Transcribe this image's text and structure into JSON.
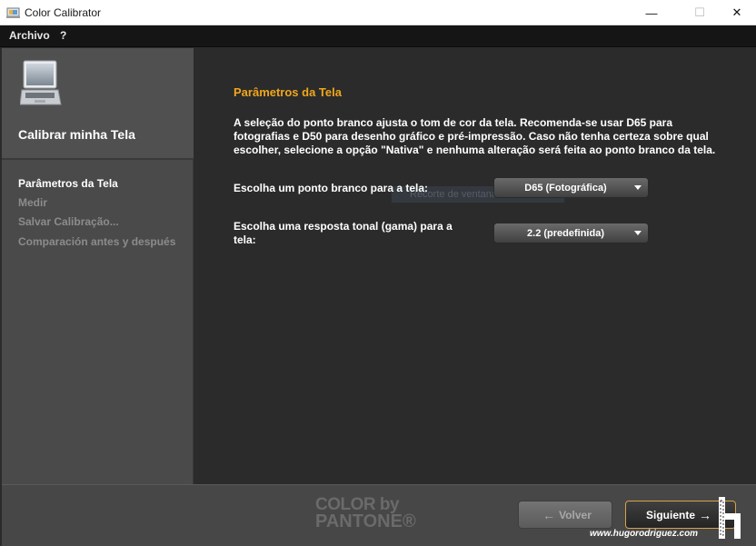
{
  "window": {
    "title": "Color Calibrator",
    "minimize": "—",
    "maximize": "☐",
    "close": "✕"
  },
  "menu": {
    "items": [
      "Archivo",
      "?"
    ]
  },
  "sidebar": {
    "title": "Calibrar minha Tela",
    "steps": [
      "Parâmetros da Tela",
      "Medir",
      "Salvar Calibração...",
      "Comparación antes y después"
    ]
  },
  "main": {
    "title": "Parâmetros da Tela",
    "description": "A seleção do ponto branco ajusta o tom de cor da tela. Recomenda-se usar D65 para fotografias e D50 para desenho gráfico e pré-impressão. Caso não tenha certeza sobre qual escolher, selecione a opção \"Nativa\" e nenhuma alteração será feita ao ponto branco da tela.",
    "white_point_label": "Escolha um ponto branco para a tela:",
    "white_point_value": "D65 (Fotográfica)",
    "tone_label": "Escolha uma resposta tonal (gama) para a tela:",
    "tone_value": "2.2 (predefinida)",
    "ghost_text": "Recorte de ventana"
  },
  "footer": {
    "brand_line1": "COLOR by",
    "brand_line2": "PANTONE®",
    "back_label": "Volver",
    "next_label": "Siguiente",
    "watermark": "www.hugorodriguez.com"
  },
  "colors": {
    "accent": "#f0a61c",
    "next_border": "#d7a247"
  }
}
